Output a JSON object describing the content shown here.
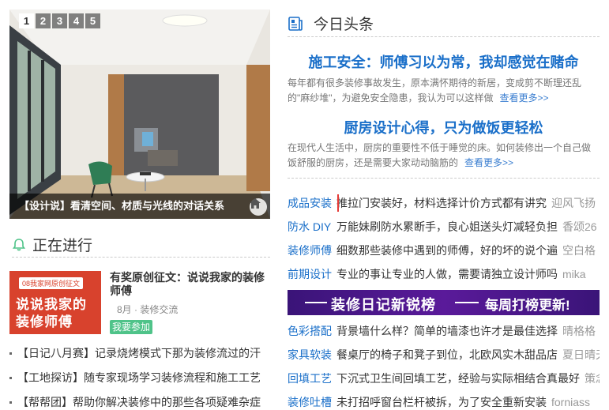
{
  "slider": {
    "tabs": [
      "1",
      "2",
      "3",
      "4",
      "5"
    ],
    "caption": "【设计说】看清空间、材质与光线的对话关系"
  },
  "ongoing": {
    "title": "正在进行",
    "promo": {
      "tag": "08我家网原创征文",
      "line1": "说说我家的",
      "line2": "装修师傅",
      "title": "有奖原创征文：说说我家的装修师傅",
      "month": "8月",
      "dot": "·",
      "category": "装修交流",
      "button": "我要参加"
    },
    "list": [
      "【日记八月赛】记录烧烤模式下那为装修流过的汗",
      "【工地探访】随专家现场学习装修流程和施工工艺",
      "【帮帮团】帮助你解决装修中的那些各项疑难杂症"
    ]
  },
  "headlines": {
    "title": "今日头条",
    "items": [
      {
        "title": "施工安全：师傅习以为常，我却感觉在赌命",
        "summary": "每年都有很多装修事故发生，原本满怀期待的新居，变成剪不断理还乱的\"麻纱堆\"，为避免安全隐患，我认为可以这样做",
        "more": "查看更多>>"
      },
      {
        "title": "厨房设计心得，只为做饭更轻松",
        "summary": "在现代人生活中，厨房的重要性不低于睡觉的床。如何装修出一个自己做饭舒服的厨房，还是需要大家动动脑筋的",
        "more": "查看更多>>"
      }
    ],
    "list1": [
      {
        "cat": "成品安装",
        "title": "推拉门安装好，材料选择计价方式都有讲究",
        "author": "迎风飞扬"
      },
      {
        "cat": "防水 DIY",
        "title": "万能妹刷防水累断手，良心姐送头灯减轻负担",
        "author": "香颂26"
      },
      {
        "cat": "装修师傅",
        "title": "细数那些装修中遇到的师傅，好的坏的说个遍",
        "author": "空白格"
      },
      {
        "cat": "前期设计",
        "title": "专业的事让专业的人做，需要请独立设计师吗",
        "author": "mika"
      }
    ],
    "banner": {
      "left": "装修日记新锐榜",
      "right": "每周打榜更新!"
    },
    "list2": [
      {
        "cat": "色彩搭配",
        "title": "背景墙什么样？简单的墙漆也许才是最佳选择",
        "author": "晴格格"
      },
      {
        "cat": "家具软装",
        "title": "餐桌厅的椅子和凳子到位，北欧风实木甜品店",
        "author": "夏日晴天"
      },
      {
        "cat": "回填工艺",
        "title": "下沉式卫生间回填工艺，经验与实际相结合真最好",
        "author": "策念"
      },
      {
        "cat": "装修吐槽",
        "title": "未打招呼窗台栏杆被拆，为了安全重新安装",
        "author": "forniass"
      }
    ]
  },
  "colors": {
    "link": "#1a6fc9",
    "highlight": "#e53935",
    "join": "#4fc389",
    "promo": "#d8422d",
    "banner": "#4a168a"
  },
  "icons": {
    "bell": "bell-icon",
    "news": "newspaper-icon",
    "home": "home-icon"
  }
}
